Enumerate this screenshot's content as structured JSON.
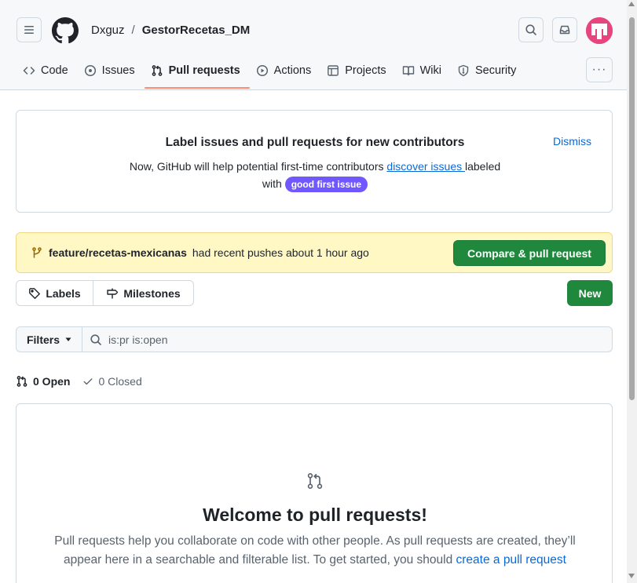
{
  "header": {
    "owner": "Dxguz",
    "separator": "/",
    "repo": "GestorRecetas_DM"
  },
  "tabs": [
    {
      "label": "Code",
      "icon": "code-icon"
    },
    {
      "label": "Issues",
      "icon": "issue-opened-icon"
    },
    {
      "label": "Pull requests",
      "icon": "git-pull-request-icon",
      "active": true
    },
    {
      "label": "Actions",
      "icon": "play-icon"
    },
    {
      "label": "Projects",
      "icon": "table-icon"
    },
    {
      "label": "Wiki",
      "icon": "book-icon"
    },
    {
      "label": "Security",
      "icon": "shield-icon"
    }
  ],
  "more_label": "···",
  "banner": {
    "title": "Label issues and pull requests for new contributors",
    "dismiss": "Dismiss",
    "text_before": "Now, GitHub will help potential first-time contributors ",
    "link": "discover issues ",
    "text_after": "labeled",
    "with": "with",
    "label_badge": "good first issue",
    "label_color": "#7057ff"
  },
  "push_notice": {
    "branch": "feature/recetas-mexicanas",
    "text": "had recent pushes about 1 hour ago",
    "button": "Compare & pull request"
  },
  "toolbar": {
    "labels": "Labels",
    "milestones": "Milestones",
    "new": "New"
  },
  "filter": {
    "button": "Filters",
    "value": "is:pr is:open"
  },
  "states": {
    "open": "0 Open",
    "closed": "0 Closed"
  },
  "blankslate": {
    "title": "Welcome to pull requests!",
    "text": "Pull requests help you collaborate on code with other people. As pull requests are created, they’ll appear here in a searchable and filterable list. To get started, you should ",
    "link": "create a pull request"
  },
  "colors": {
    "accent": "#0969da",
    "primary_button": "#1f883d",
    "active_tab_underline": "#fd8c73",
    "notice_bg": "#fff8c5"
  }
}
